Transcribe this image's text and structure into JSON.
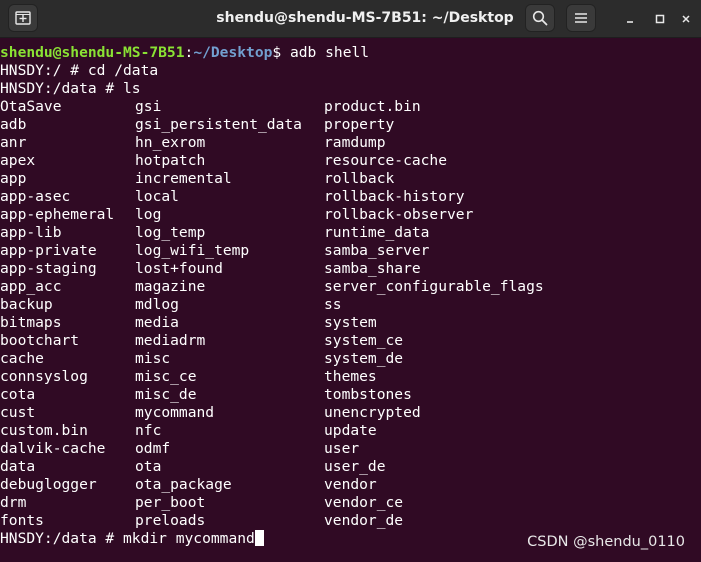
{
  "window": {
    "title": "shendu@shendu-MS-7B51: ~/Desktop"
  },
  "colors": {
    "background": "#300a24",
    "prompt_user": "#8ae234",
    "prompt_path": "#729fcf",
    "text": "#ffffff"
  },
  "icons": {
    "new_tab": "new-tab-icon",
    "search": "search-icon",
    "menu": "hamburger-menu-icon",
    "minimize": "minimize-icon",
    "maximize": "maximize-icon",
    "close": "close-icon"
  },
  "terminal": {
    "prompt": {
      "user_host": "shendu@shendu-MS-7B51",
      "separator": ":",
      "path": "~/Desktop",
      "symbol": "$",
      "command": " adb shell"
    },
    "lines": [
      "HNSDY:/ # cd /data",
      "HNSDY:/data # ls"
    ],
    "listing": {
      "col1": [
        "OtaSave",
        "adb",
        "anr",
        "apex",
        "app",
        "app-asec",
        "app-ephemeral",
        "app-lib",
        "app-private",
        "app-staging",
        "app_acc",
        "backup",
        "bitmaps",
        "bootchart",
        "cache",
        "connsyslog",
        "cota",
        "cust",
        "custom.bin",
        "dalvik-cache",
        "data",
        "debuglogger",
        "drm",
        "fonts"
      ],
      "col2": [
        "gsi",
        "gsi_persistent_data",
        "hn_exrom",
        "hotpatch",
        "incremental",
        "local",
        "log",
        "log_temp",
        "log_wifi_temp",
        "lost+found",
        "magazine",
        "mdlog",
        "media",
        "mediadrm",
        "misc",
        "misc_ce",
        "misc_de",
        "mycommand",
        "nfc",
        "odmf",
        "ota",
        "ota_package",
        "per_boot",
        "preloads"
      ],
      "col3": [
        "product.bin",
        "property",
        "ramdump",
        "resource-cache",
        "rollback",
        "rollback-history",
        "rollback-observer",
        "runtime_data",
        "samba_server",
        "samba_share",
        "server_configurable_flags",
        "ss",
        "system",
        "system_ce",
        "system_de",
        "themes",
        "tombstones",
        "unencrypted",
        "update",
        "user",
        "user_de",
        "vendor",
        "vendor_ce",
        "vendor_de"
      ]
    },
    "last_line": "HNSDY:/data # mkdir mycommand"
  },
  "watermark": "CSDN @shendu_0110"
}
